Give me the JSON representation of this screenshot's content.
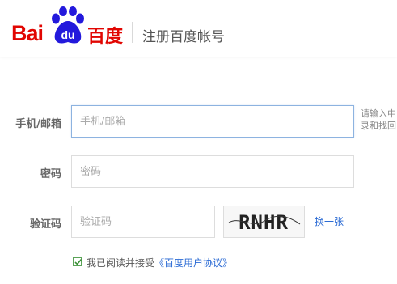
{
  "header": {
    "logo_latin": "Bai",
    "logo_paw_text": "du",
    "logo_cn": "百度",
    "title": "注册百度帐号"
  },
  "form": {
    "phone_email": {
      "label": "手机/邮箱",
      "placeholder": "手机/邮箱",
      "hint_line1": "请输入中",
      "hint_line2": "录和找回"
    },
    "password": {
      "label": "密码",
      "placeholder": "密码"
    },
    "captcha": {
      "label": "验证码",
      "placeholder": "验证码",
      "captcha_text": "RNHR",
      "refresh_label": "换一张"
    },
    "agreement": {
      "checked": true,
      "text": "我已阅读并接受",
      "link": "《百度用户协议》"
    }
  },
  "colors": {
    "brand_red": "#e10602",
    "brand_blue": "#2319dc",
    "link_blue": "#2a6ad4",
    "focus_border": "#8db3e0"
  }
}
